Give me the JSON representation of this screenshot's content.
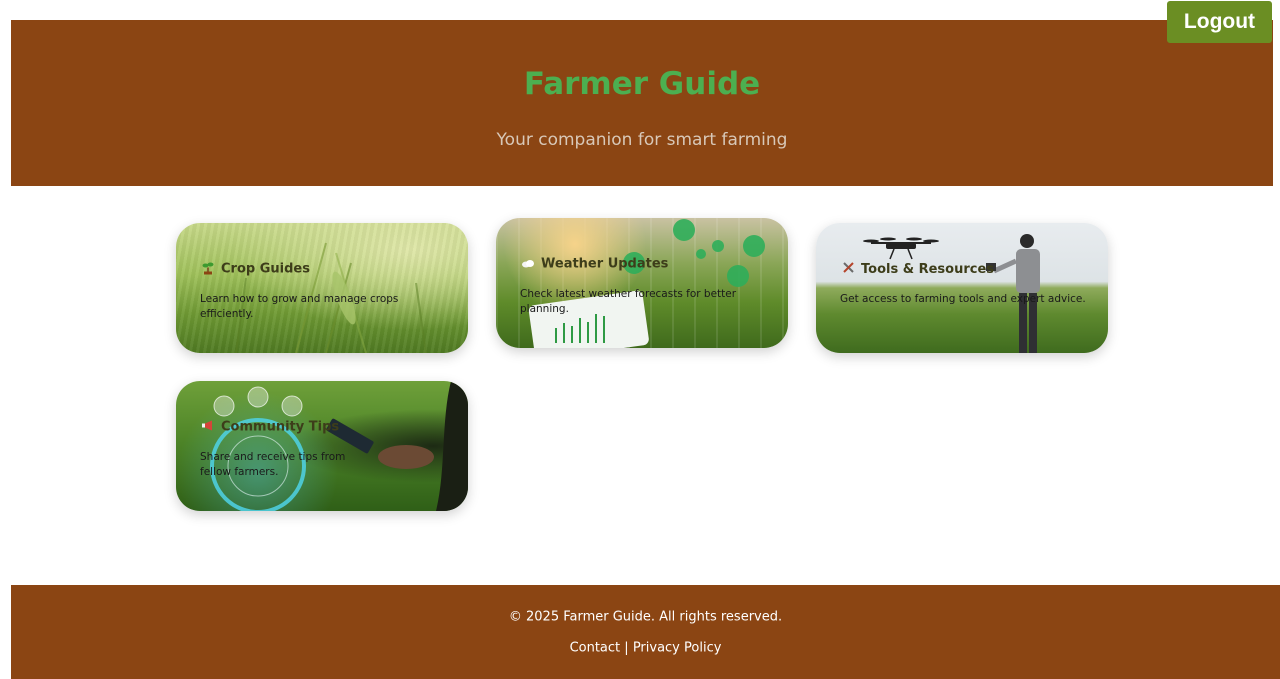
{
  "topbar": {
    "logout_label": "Logout"
  },
  "header": {
    "title": "Farmer Guide",
    "subtitle": "Your companion for smart farming"
  },
  "cards": [
    {
      "icon": "seedling-icon",
      "title": "Crop Guides",
      "description": "Learn how to grow and manage crops efficiently."
    },
    {
      "icon": "cloud-icon",
      "title": "Weather Updates",
      "description": "Check latest weather forecasts for better planning."
    },
    {
      "icon": "tools-icon",
      "title": "Tools & Resources",
      "description": "Get access to farming tools and expert advice."
    },
    {
      "icon": "megaphone-icon",
      "title": "Community Tips",
      "description": "Share and receive tips from fellow farmers."
    }
  ],
  "footer": {
    "copyright": "© 2025 Farmer Guide. All rights reserved.",
    "contact_label": "Contact",
    "separator": "|",
    "privacy_label": "Privacy Policy"
  },
  "colors": {
    "brown": "#8b4513",
    "title_green": "#4caf50",
    "logout_green": "#6b8e23"
  }
}
